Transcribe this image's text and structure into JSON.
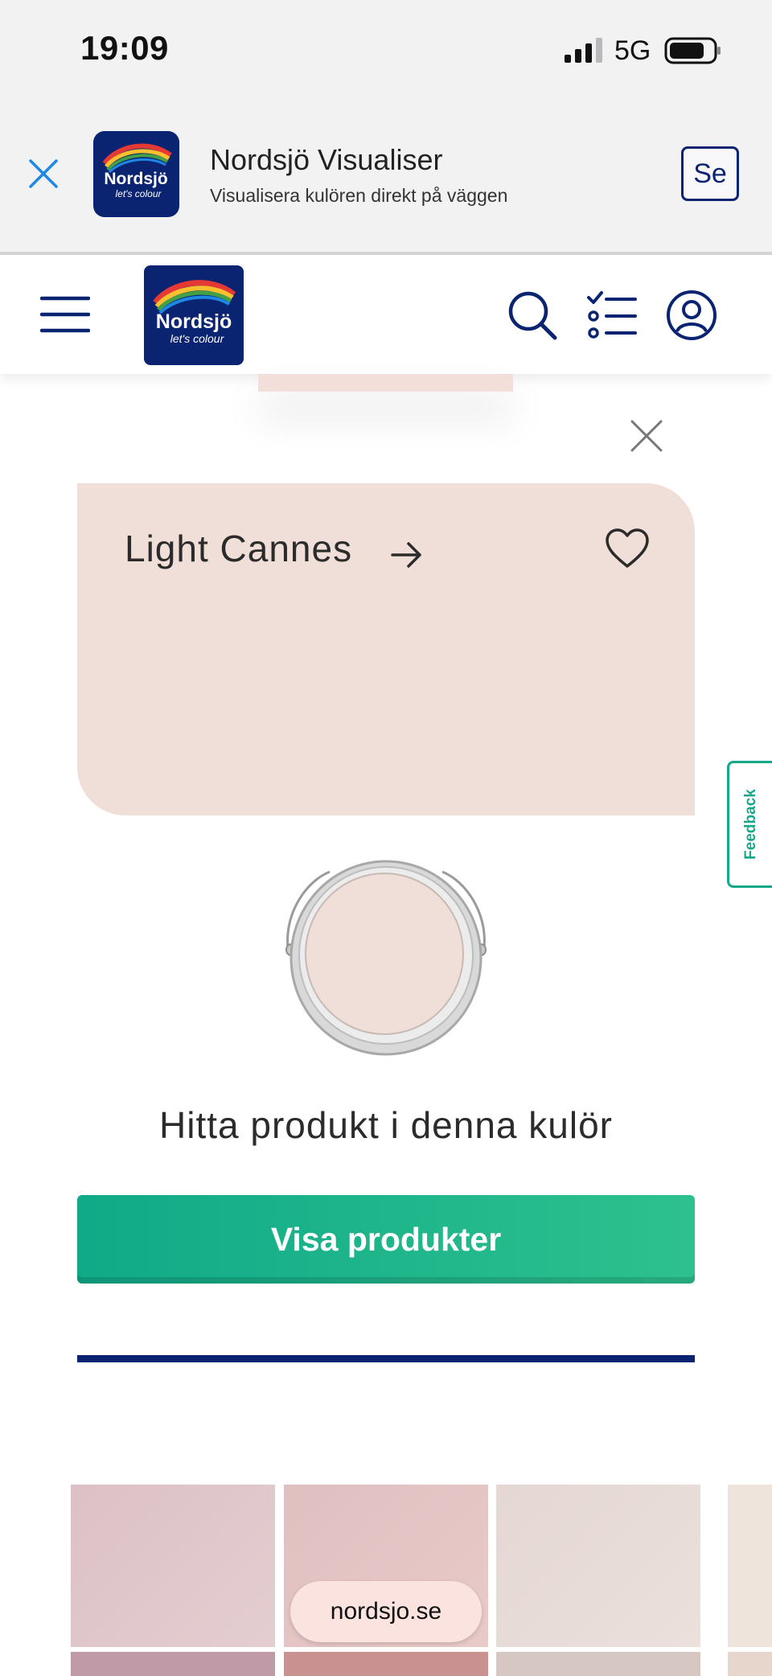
{
  "status_bar": {
    "time": "19:09",
    "network": "5G",
    "signal_icon": "cellular-signal-icon",
    "battery_icon": "battery-icon"
  },
  "app_banner": {
    "title": "Nordsjö Visualiser",
    "subtitle": "Visualisera kulören direkt på väggen",
    "open_label": "Se",
    "logo_text": "Nordsjö",
    "logo_tagline": "let's colour"
  },
  "header": {
    "logo_text": "Nordsjö",
    "logo_tagline": "let's colour",
    "icons": [
      "menu-icon",
      "search-icon",
      "checklist-icon",
      "user-icon"
    ]
  },
  "colour": {
    "name": "Light Cannes",
    "hex": "#f0dfd9"
  },
  "product_section": {
    "title": "Hitta produkt i denna kulör",
    "button_label": "Visa produkter"
  },
  "feedback": {
    "label": "Feedback"
  },
  "swatches": [
    {
      "color": "#ddc3c8"
    },
    {
      "color": "#e2c2c2"
    },
    {
      "color": "#e6d9d6"
    },
    {
      "color": "#efe4dc"
    }
  ],
  "browser": {
    "url": "nordsjo.se"
  },
  "colors": {
    "brand_navy": "#0b2472",
    "accent_green": "#17a889"
  }
}
